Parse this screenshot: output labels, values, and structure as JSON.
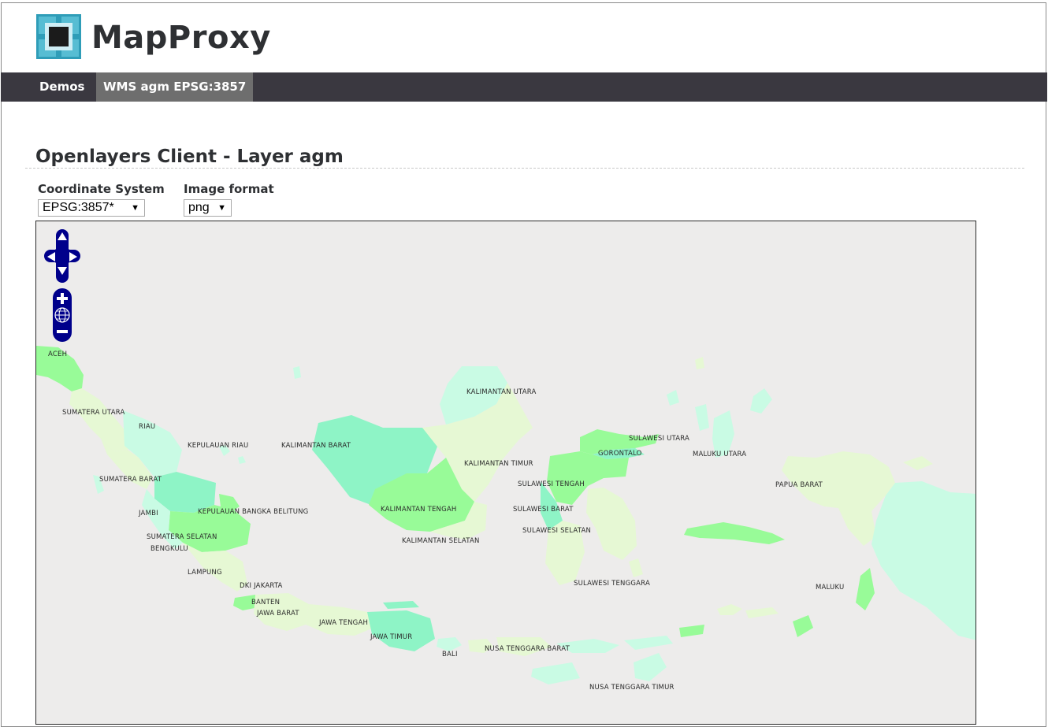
{
  "header": {
    "brand": "MapProxy",
    "logo_icon": "mapproxy-logo"
  },
  "nav": {
    "items": [
      {
        "label": "Demos",
        "active": false
      },
      {
        "label": "WMS agm EPSG:3857",
        "active": true
      }
    ]
  },
  "main": {
    "title": "Openlayers Client - Layer agm",
    "coordinate_system": {
      "label": "Coordinate System",
      "value": "EPSG:3857*"
    },
    "image_format": {
      "label": "Image format",
      "value": "png"
    }
  },
  "map": {
    "controls": [
      "pan-up-icon",
      "pan-left-icon",
      "pan-right-icon",
      "pan-down-icon",
      "zoom-in-icon",
      "zoom-world-icon",
      "zoom-out-icon"
    ],
    "labels": {
      "aceh": "ACEH",
      "sumatera_utara": "SUMATERA UTARA",
      "riau": "RIAU",
      "kepulauan_riau": "KEPULAUAN RIAU",
      "sumatera_barat": "SUMATERA BARAT",
      "jambi": "JAMBI",
      "kepulauan_bangka_belitung": "KEPULAUAN BANGKA BELITUNG",
      "sumatera_selatan": "SUMATERA SELATAN",
      "bengkulu": "BENGKULU",
      "lampung": "LAMPUNG",
      "dki_jakarta": "DKI JAKARTA",
      "banten": "BANTEN",
      "jawa_barat": "JAWA BARAT",
      "jawa_tengah": "JAWA TENGAH",
      "jawa_timur": "JAWA TIMUR",
      "bali": "BALI",
      "nusa_tenggara_barat": "NUSA TENGGARA BARAT",
      "nusa_tenggara_timur": "NUSA TENGGARA TIMUR",
      "kalimantan_utara": "KALIMANTAN UTARA",
      "kalimantan_barat": "KALIMANTAN BARAT",
      "kalimantan_timur": "KALIMANTAN TIMUR",
      "kalimantan_tengah": "KALIMANTAN TENGAH",
      "kalimantan_selatan": "KALIMANTAN SELATAN",
      "sulawesi_utara": "SULAWESI UTARA",
      "gorontalo": "GORONTALO",
      "maluku_utara": "MALUKU UTARA",
      "sulawesi_tengah": "SULAWESI TENGAH",
      "sulawesi_barat": "SULAWESI BARAT",
      "sulawesi_selatan": "SULAWESI SELATAN",
      "sulawesi_tenggara": "SULAWESI TENGGARA",
      "papua_barat": "PAPUA BARAT",
      "maluku": "MALUKU"
    },
    "colors": {
      "background": "#edeceb",
      "light": "#e6f8d4",
      "mint": "#c9fbe4",
      "aqua": "#8ef4c6",
      "green": "#98fb98",
      "pale": "#d9f9c4"
    }
  }
}
